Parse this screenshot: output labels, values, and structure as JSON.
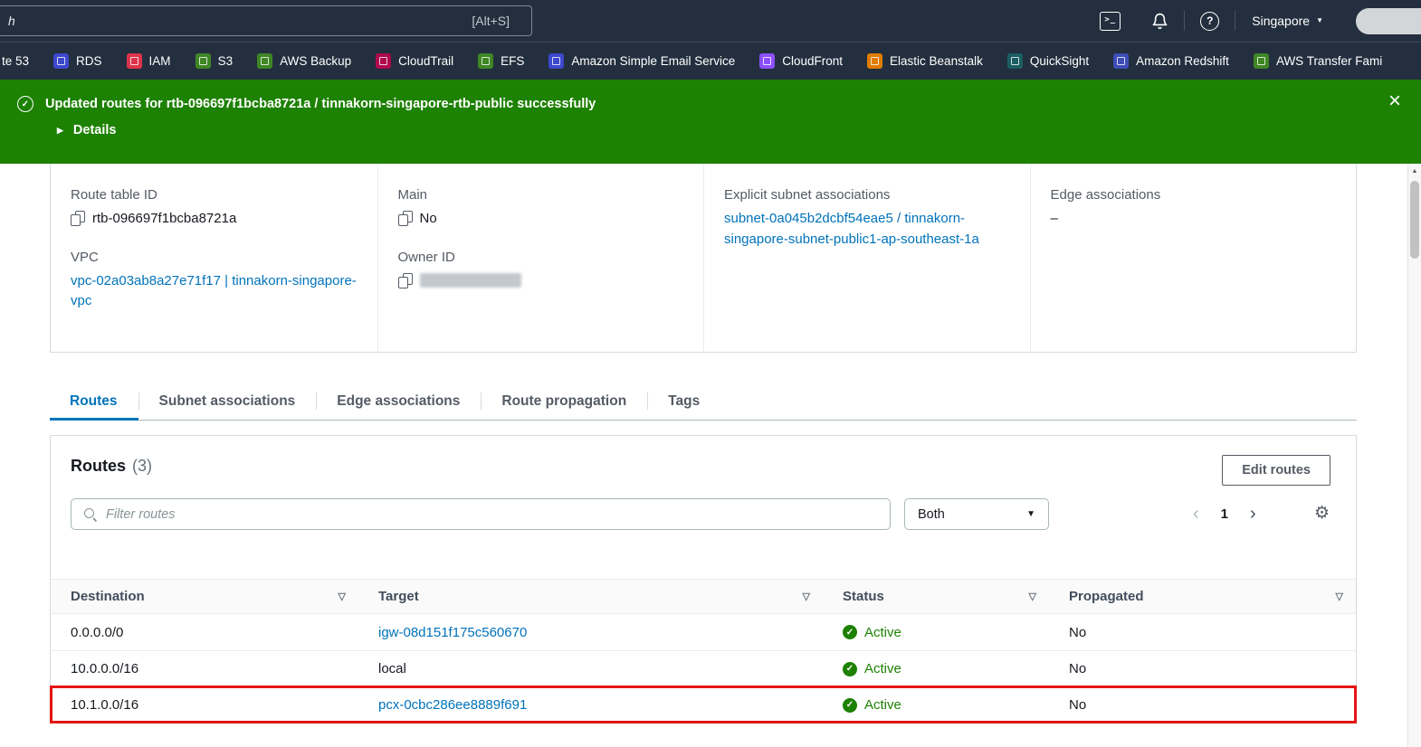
{
  "topnav": {
    "search_fragment": "h",
    "search_hint": "[Alt+S]",
    "region_label": "Singapore"
  },
  "services_bar": {
    "items": [
      {
        "label": "te 53",
        "color": ""
      },
      {
        "label": "RDS",
        "color": "#3b48cc"
      },
      {
        "label": "IAM",
        "color": "#dd344c"
      },
      {
        "label": "S3",
        "color": "#3f8624"
      },
      {
        "label": "AWS Backup",
        "color": "#3f8624"
      },
      {
        "label": "CloudTrail",
        "color": "#b0084d"
      },
      {
        "label": "EFS",
        "color": "#3f8624"
      },
      {
        "label": "Amazon Simple Email Service",
        "color": "#3b48cc"
      },
      {
        "label": "CloudFront",
        "color": "#8c4fff"
      },
      {
        "label": "Elastic Beanstalk",
        "color": "#e07c00"
      },
      {
        "label": "QuickSight",
        "color": "#1b5e63"
      },
      {
        "label": "Amazon Redshift",
        "color": "#3e4db8"
      },
      {
        "label": "AWS Transfer Fami",
        "color": "#3f8624"
      }
    ]
  },
  "flashbar": {
    "message": "Updated routes for rtb-096697f1bcba8721a / tinnakorn-singapore-rtb-public successfully",
    "details_label": "Details"
  },
  "summary": {
    "route_table_id_label": "Route table ID",
    "route_table_id": "rtb-096697f1bcba8721a",
    "vpc_label": "VPC",
    "vpc_value": "vpc-02a03ab8a27e71f17 | tinnakorn-singapore-vpc",
    "main_label": "Main",
    "main_value": "No",
    "owner_label": "Owner ID",
    "explicit_label": "Explicit subnet associations",
    "explicit_value": "subnet-0a045b2dcbf54eae5 / tinnakorn-singapore-subnet-public1-ap-southeast-1a",
    "edge_label": "Edge associations",
    "edge_value": "–"
  },
  "tabs": [
    {
      "label": "Routes"
    },
    {
      "label": "Subnet associations"
    },
    {
      "label": "Edge associations"
    },
    {
      "label": "Route propagation"
    },
    {
      "label": "Tags"
    }
  ],
  "routes_panel": {
    "title": "Routes",
    "count": "(3)",
    "edit_button_label": "Edit routes",
    "filter_placeholder": "Filter routes",
    "filter_mode": "Both",
    "page_number": "1",
    "columns": [
      "Destination",
      "Target",
      "Status",
      "Propagated"
    ],
    "rows": [
      {
        "destination": "0.0.0.0/0",
        "target": "igw-08d151f175c560670",
        "status": "Active",
        "propagated": "No"
      },
      {
        "destination": "10.0.0.0/16",
        "target": "local",
        "status": "Active",
        "propagated": "No"
      },
      {
        "destination": "10.1.0.0/16",
        "target": "pcx-0cbc286ee8889f691",
        "status": "Active",
        "propagated": "No"
      }
    ]
  },
  "icons": {
    "terminal": "&gt;_",
    "help": "?",
    "caret_down": "▼",
    "success_check": "✓",
    "expand_triangle": "▶",
    "close": "×",
    "sort_triangle": "▽",
    "chevron_left": "‹",
    "chevron_right": "›",
    "gear": "⚙",
    "status_check": "✓",
    "scroll_up": "▲"
  },
  "colors": {
    "flash_green": "#1d8102",
    "status_green": "#1d8102",
    "link_blue": "#0073bb",
    "highlight_red": "#e41414",
    "nav_dark": "#232f3e"
  }
}
